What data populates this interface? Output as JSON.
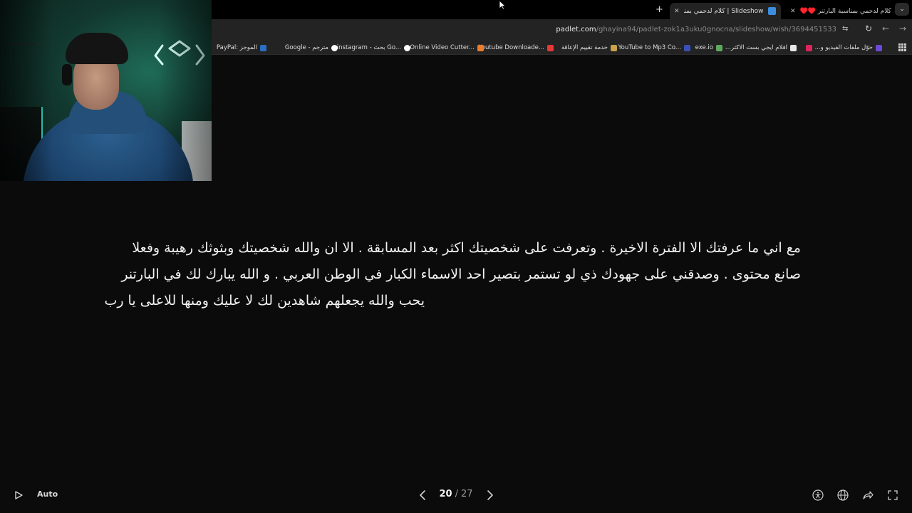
{
  "browser": {
    "tabs": [
      {
        "title": "كلام لدحمي بمناسبة البارتنر ♥️♥️",
        "favicon_color": "#b8a580",
        "active": false
      },
      {
        "title": "Slideshow | كلام لدحمي بمناسبة البارتنر",
        "favicon_color": "#3b8de0",
        "active": true
      }
    ],
    "new_tab_label": "+",
    "url_host": "padlet.com",
    "url_path": "/ghayina94/padlet-zok1a3uku0gnocna/slideshow/wish/3694451533"
  },
  "bookmarks": [
    {
      "label": "حوّل ملفات الفيديو و...",
      "icon_color": "#6c4ad6"
    },
    {
      "label": "",
      "icon_color": "#e0245e"
    },
    {
      "label": "افلام ايجي بست الاكثر...",
      "icon_color": "#e8e8e8"
    },
    {
      "label": "exe.io",
      "icon_color": "#5fa95f"
    },
    {
      "label": "YouTube to Mp3 Co...",
      "icon_color": "#3b4fb8"
    },
    {
      "label": "خدمة تقييم الإعاقة",
      "icon_color": "#c9a24a"
    },
    {
      "label": "Youtube Downloade...",
      "icon_color": "#e53935"
    },
    {
      "label": "Online Video Cutter...",
      "icon_color": "#ea7c2b"
    },
    {
      "label": "instagram - بحث Go...",
      "icon_color": "#ffffff"
    },
    {
      "label": "Google - مترجم",
      "icon_color": "#ffffff"
    },
    {
      "label": "PayPal: الموجز",
      "icon_color": "#2b6fc4"
    }
  ],
  "slide": {
    "lines": [
      "مع اني ما عرفتك الا الفترة الاخيرة . وتعرفت على شخصيتك اكثر بعد المسابقة . الا ان والله شخصيتك وبثوثك رهيبة وفعلا",
      "صانع محتوى . وصدقني على جهودك ذي لو تستمر بتصير احد الاسماء الكبار في الوطن العربي . و الله يبارك لك في البارتنر",
      "يحب والله يجعلهم شاهدين لك لا عليك ومنها للاعلى يا رب"
    ]
  },
  "controls": {
    "auto_label": "Auto",
    "current": "20",
    "separator": "/",
    "total": "27"
  }
}
